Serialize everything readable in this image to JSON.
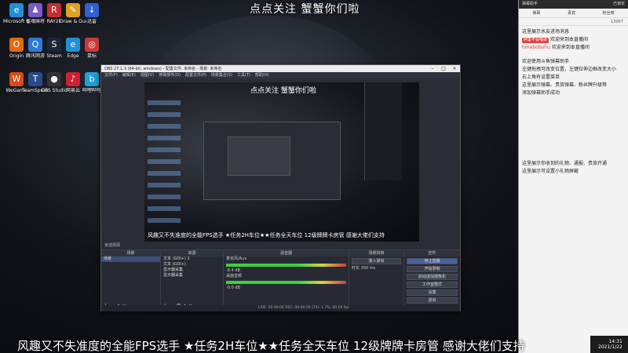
{
  "top_caption": "点点关注 蟹蟹你们啦",
  "bottom_caption": "风趣又不失准度的全能FPS选手 ★任务2H车位★★任务全天车位 12级牌牌卡房管 感谢大佬们支持",
  "desktop_icons": [
    {
      "label": "Microsoft Edge",
      "glyph": "e",
      "color": "#1f8fd6"
    },
    {
      "label": "雀魂麻将",
      "glyph": "♟",
      "color": "#7a5ac8"
    },
    {
      "label": "RAY2E",
      "glyph": "R",
      "color": "#c03030"
    },
    {
      "label": "Draw & Guess",
      "glyph": "✎",
      "color": "#e0a020"
    },
    {
      "label": "迅雷",
      "glyph": "↓",
      "color": "#3060d0"
    },
    {
      "label": "Origin",
      "glyph": "O",
      "color": "#e06a10"
    },
    {
      "label": "腾讯网游",
      "glyph": "Q",
      "color": "#2a7ad8"
    },
    {
      "label": "Steam",
      "glyph": "S",
      "color": "#1b2838"
    },
    {
      "label": "Edge",
      "glyph": "e",
      "color": "#1f8fd6"
    },
    {
      "label": "鼠标",
      "glyph": "◎",
      "color": "#c83a3a"
    },
    {
      "label": "WeGame",
      "glyph": "W",
      "color": "#d84a1a"
    },
    {
      "label": "TeamSpeak",
      "glyph": "T",
      "color": "#2a4a8a"
    },
    {
      "label": "OBS Studio",
      "glyph": "●",
      "color": "#333"
    },
    {
      "label": "网易云",
      "glyph": "♪",
      "color": "#d02030"
    },
    {
      "label": "哔哩哔哩",
      "glyph": "b",
      "color": "#20a0d8"
    }
  ],
  "chat": {
    "header_left": "弹幕助手",
    "header_right": "已锁定",
    "tabs": [
      "弹幕",
      "贵宾",
      "粉丝榜"
    ],
    "stats": "13057",
    "messages": [
      "这里展示水友进场消息",
      "欢迎来到本直播间",
      "欢迎来到本直播间",
      "欢迎使用斗鱼弹幕助手",
      "左键拖拽可改变位置，左键拉伸边框改变大小",
      "右上角有设置菜单",
      "这里展示弹幕、贵族弹幕、粉丝牌升级等",
      "添加弹幕助手成功",
      "这里展示你收到的礼物、通报、贵族开通",
      "这里展示可设置小礼物屏蔽"
    ],
    "badge1": "阿善不会唱歌",
    "badge2": "hmebobohu"
  },
  "time": {
    "clock": "14:31",
    "date": "2021/1/22"
  },
  "obs": {
    "title": "OBS 27.1.3 (64-bit, windows) - 配置文件: 未命名 - 场景: 未命名",
    "menu": [
      "文件(F)",
      "编辑(E)",
      "视图(V)",
      "停靠部件(D)",
      "配置文件(P)",
      "场景集合(S)",
      "工具(T)",
      "帮助(H)"
    ],
    "scene_label": "未选择源",
    "docks": {
      "scenes": {
        "title": "场景",
        "items": [
          "场景"
        ]
      },
      "sources": {
        "title": "来源",
        "items": [
          "文本 (GDI+) 2",
          "文本 (GDI+)",
          "显示器采集",
          "显示器采集"
        ]
      },
      "mixer": {
        "title": "混音器",
        "channels": [
          {
            "name": "麦克风/Aux",
            "db": "-8.4 dB"
          },
          {
            "name": "桌面音频",
            "db": "-0.0 dB"
          }
        ]
      },
      "transitions": {
        "title": "场景转换",
        "type": "渐入渐出",
        "duration_label": "时长",
        "duration": "300 ms"
      },
      "controls": {
        "title": "控件",
        "buttons": [
          "停止直播",
          "开始录制",
          "启动虚拟摄像机",
          "工作室模式",
          "设置",
          "退出"
        ]
      }
    },
    "status": "LIVE: 00:00:00   REC: 00:00:00   CPU: 1.7%, 60.00 fps",
    "preview_top": "点点关注 蟹蟹你们啦",
    "preview_bottom": "风趣又不失准度的全能FPS选手 ★任务2H车位★★任务全天车位 12级牌牌卡房管 感谢大佬们支持"
  }
}
